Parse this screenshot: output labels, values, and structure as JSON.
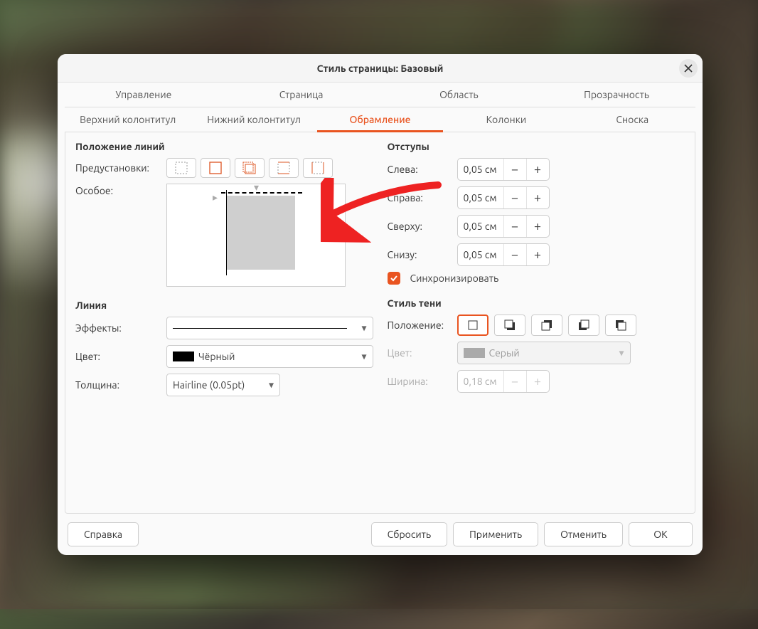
{
  "title": "Стиль страницы: Базовый",
  "tabsRow1": [
    {
      "label": "Управление"
    },
    {
      "label": "Страница"
    },
    {
      "label": "Область"
    },
    {
      "label": "Прозрачность"
    }
  ],
  "tabsRow2": [
    {
      "label": "Верхний колонтитул"
    },
    {
      "label": "Нижний колонтитул"
    },
    {
      "label": "Обрамление",
      "active": true
    },
    {
      "label": "Колонки"
    },
    {
      "label": "Сноска"
    }
  ],
  "lines": {
    "section": "Положение линий",
    "presets_label": "Предустановки:",
    "custom_label": "Особое:"
  },
  "lineStyle": {
    "section": "Линия",
    "effects_label": "Эффекты:",
    "color_label": "Цвет:",
    "color_value": "Чёрный",
    "width_label": "Толщина:",
    "width_value": "Hairline (0.05pt)"
  },
  "padding": {
    "section": "Отступы",
    "left_label": "Слева:",
    "left_value": "0,05 см",
    "right_label": "Справа:",
    "right_value": "0,05 см",
    "top_label": "Сверху:",
    "top_value": "0,05 см",
    "bottom_label": "Снизу:",
    "bottom_value": "0,05 см",
    "sync_label": "Синхронизировать"
  },
  "shadow": {
    "section": "Стиль тени",
    "position_label": "Положение:",
    "color_label": "Цвет:",
    "color_value": "Серый",
    "width_label": "Ширина:",
    "width_value": "0,18 см"
  },
  "footer": {
    "help": "Справка",
    "reset": "Сбросить",
    "apply": "Применить",
    "cancel": "Отменить",
    "ok": "OK"
  }
}
